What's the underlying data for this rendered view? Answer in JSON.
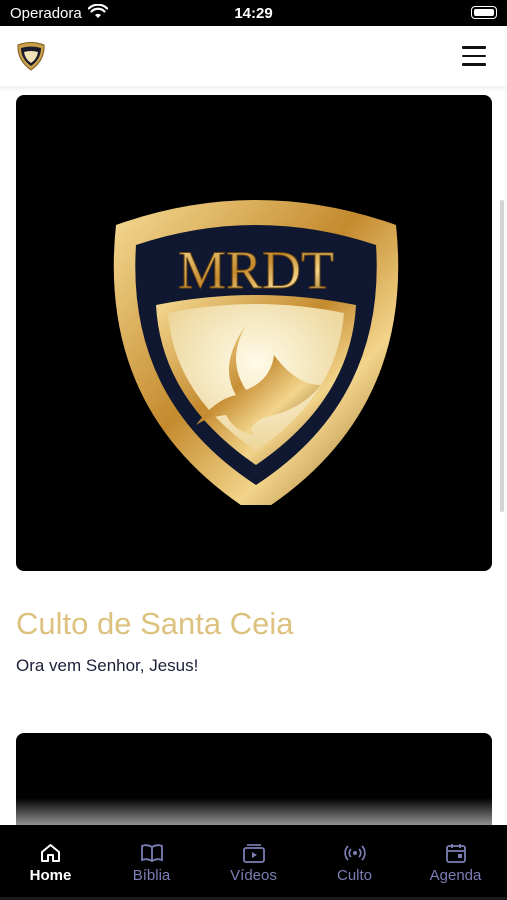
{
  "status": {
    "carrier": "Operadora",
    "time": "14:29"
  },
  "header": {
    "logo_icon": "mrdt-shield-logo",
    "menu_icon": "hamburger-menu-icon"
  },
  "feed": {
    "items": [
      {
        "image_icon": "mrdt-shield-emblem",
        "emblem_text": "MRDT",
        "title": "Culto de Santa Ceia",
        "subtitle": "Ora vem Senhor, Jesus!"
      }
    ]
  },
  "tabs": [
    {
      "label": "Home",
      "icon": "home-icon",
      "active": true
    },
    {
      "label": "Bíblia",
      "icon": "book-icon",
      "active": false
    },
    {
      "label": "Vídeos",
      "icon": "video-icon",
      "active": false
    },
    {
      "label": "Culto",
      "icon": "broadcast-icon",
      "active": false
    },
    {
      "label": "Agenda",
      "icon": "calendar-icon",
      "active": false
    }
  ],
  "colors": {
    "accent_gold": "#dcc27e",
    "tab_inactive": "#7b7fb4",
    "tab_active": "#ffffff",
    "text_dark": "#1b2038"
  }
}
